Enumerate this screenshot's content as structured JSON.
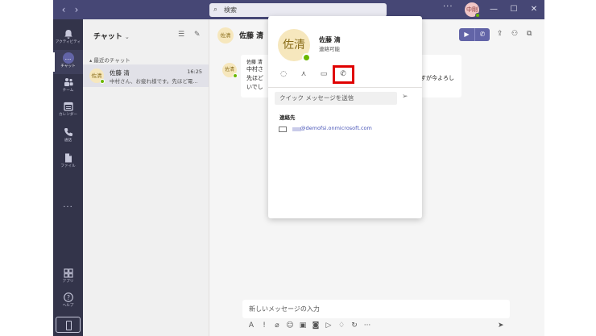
{
  "titlebar": {
    "back": "‹",
    "forward": "›",
    "search_placeholder": "検索",
    "more": "···",
    "user_avatar_initials": "中剛",
    "minimize": "—",
    "maximize": "☐",
    "close": "✕"
  },
  "appbar": {
    "items": [
      {
        "label": "アクティビティ",
        "icon": "bell-icon"
      },
      {
        "label": "チャット",
        "icon": "chat-icon"
      },
      {
        "label": "チーム",
        "icon": "teams-icon"
      },
      {
        "label": "カレンダー",
        "icon": "calendar-icon"
      },
      {
        "label": "通話",
        "icon": "phone-icon"
      },
      {
        "label": "ファイル",
        "icon": "file-icon"
      }
    ],
    "more": "···",
    "apps_label": "アプリ",
    "help_label": "ヘルプ"
  },
  "chatlist": {
    "title": "チャット",
    "section": "最近のチャット",
    "items": [
      {
        "initials": "佐清",
        "name": "佐藤 清",
        "time": "16:25",
        "preview": "中村さん、お疲れ様です。先ほど電..."
      }
    ]
  },
  "main": {
    "header_initials": "佐清",
    "header_name": "佐藤 清",
    "message": {
      "initials": "佐清",
      "lines": [
        "佐藤 清",
        "中村さ",
        "先ほど",
        "いでし"
      ],
      "right_text": "すが今よろし"
    },
    "compose_placeholder": "新しいメッセージの入力"
  },
  "profile_card": {
    "initials": "佐清",
    "name": "佐藤 清",
    "status": "連絡可能",
    "quick_message_placeholder": "クイック メッセージを送信",
    "contact_heading": "連絡先",
    "email": "@demofsi.onmicrosoft.com"
  },
  "colors": {
    "titlebar": "#464775",
    "appbar": "#33344a",
    "accent": "#6264a7",
    "available": "#6bb700",
    "highlight": "#e00000"
  }
}
